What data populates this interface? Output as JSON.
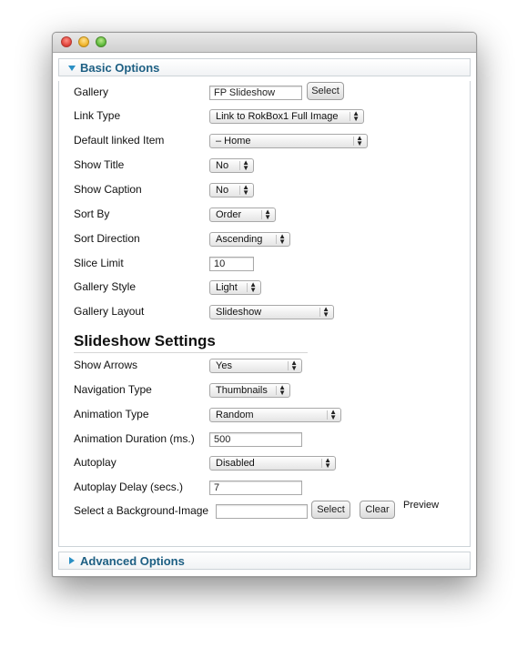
{
  "window": {
    "controls": [
      "close",
      "minimize",
      "zoom"
    ]
  },
  "basic_options": {
    "title": "Basic Options",
    "gallery": {
      "label": "Gallery",
      "value": "FP Slideshow",
      "button": "Select"
    },
    "link_type": {
      "label": "Link Type",
      "value": "Link to RokBox1 Full Image"
    },
    "default_linked_item": {
      "label": "Default linked Item",
      "value": "– Home"
    },
    "show_title": {
      "label": "Show Title",
      "value": "No"
    },
    "show_caption": {
      "label": "Show Caption",
      "value": "No"
    },
    "sort_by": {
      "label": "Sort By",
      "value": "Order"
    },
    "sort_direction": {
      "label": "Sort Direction",
      "value": "Ascending"
    },
    "slice_limit": {
      "label": "Slice Limit",
      "value": "10"
    },
    "gallery_style": {
      "label": "Gallery Style",
      "value": "Light"
    },
    "gallery_layout": {
      "label": "Gallery Layout",
      "value": "Slideshow"
    }
  },
  "slideshow_settings": {
    "title": "Slideshow Settings",
    "show_arrows": {
      "label": "Show Arrows",
      "value": "Yes"
    },
    "navigation_type": {
      "label": "Navigation Type",
      "value": "Thumbnails"
    },
    "animation_type": {
      "label": "Animation Type",
      "value": "Random"
    },
    "animation_duration": {
      "label": "Animation Duration (ms.)",
      "value": "500"
    },
    "autoplay": {
      "label": "Autoplay",
      "value": "Disabled"
    },
    "autoplay_delay": {
      "label": "Autoplay Delay (secs.)",
      "value": "7"
    },
    "background_image": {
      "label": "Select a Background-Image",
      "value": "",
      "select_button": "Select",
      "clear_button": "Clear",
      "preview_label": "Preview"
    }
  },
  "advanced_options": {
    "title": "Advanced Options"
  },
  "colors": {
    "panel_title": "#1d5f83",
    "toggle_triangle": "#2a8fc4"
  }
}
